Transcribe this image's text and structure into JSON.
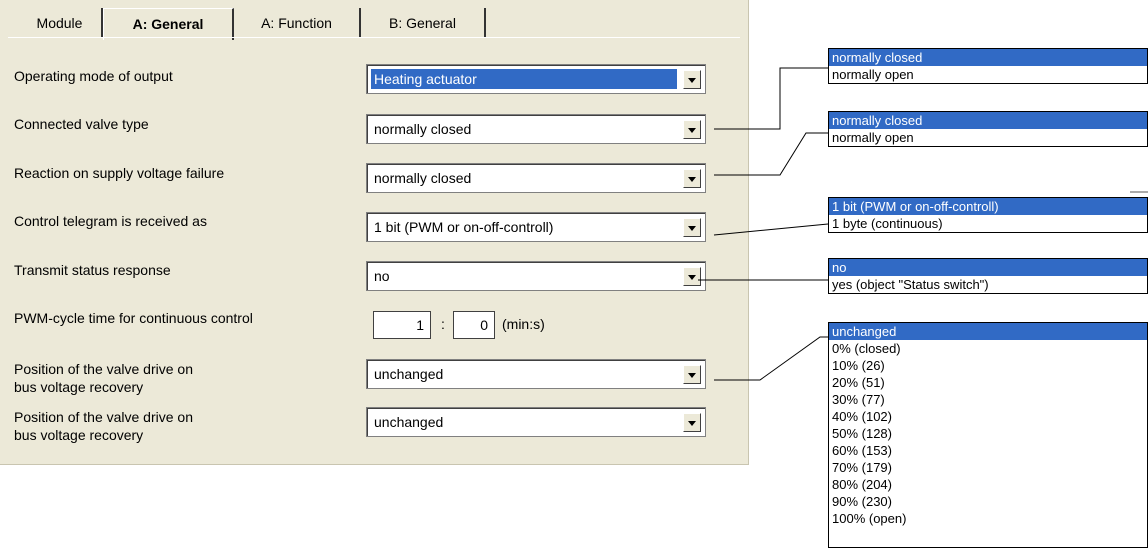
{
  "tabs": [
    "Module",
    "A: General",
    "A: Function",
    "B: General"
  ],
  "rows": [
    {
      "label": "Operating mode of output",
      "value": "Heating actuator"
    },
    {
      "label": "Connected valve type",
      "value": "normally closed"
    },
    {
      "label": "Reaction on supply voltage failure",
      "value": "normally closed"
    },
    {
      "label": "Control telegram is received as",
      "value": "1 bit (PWM or on-off-controll)"
    },
    {
      "label": "Transmit status response",
      "value": "no"
    },
    {
      "label": "PWM-cycle time for continuous control",
      "min": "1",
      "sep": ":",
      "sec": "0",
      "unit": "(min:s)"
    },
    {
      "label_line1": "Position of the valve drive on",
      "label_line2": "bus voltage recovery",
      "value": "unchanged"
    },
    {
      "label_line1": "Position of the valve drive on",
      "label_line2": "bus voltage recovery",
      "value": "unchanged"
    }
  ],
  "lists": {
    "valve_type_options": [
      "normally closed",
      "normally open"
    ],
    "supply_failure_options": [
      "normally closed",
      "normally open"
    ],
    "telegram_options": [
      "1 bit (PWM or on-off-controll)",
      "1 byte (continuous)"
    ],
    "status_options": [
      "no",
      "yes (object \"Status switch\")"
    ],
    "recovery_options": [
      "unchanged",
      "0% (closed)",
      "10%  (26)",
      "20%  (51)",
      "30%  (77)",
      "40%  (102)",
      "50%  (128)",
      "60%  (153)",
      "70%  (179)",
      "80%  (204)",
      "90%  (230)",
      "100% (open)"
    ]
  },
  "colors": {
    "panel": "#ece9d8",
    "selection": "#316ac5"
  }
}
